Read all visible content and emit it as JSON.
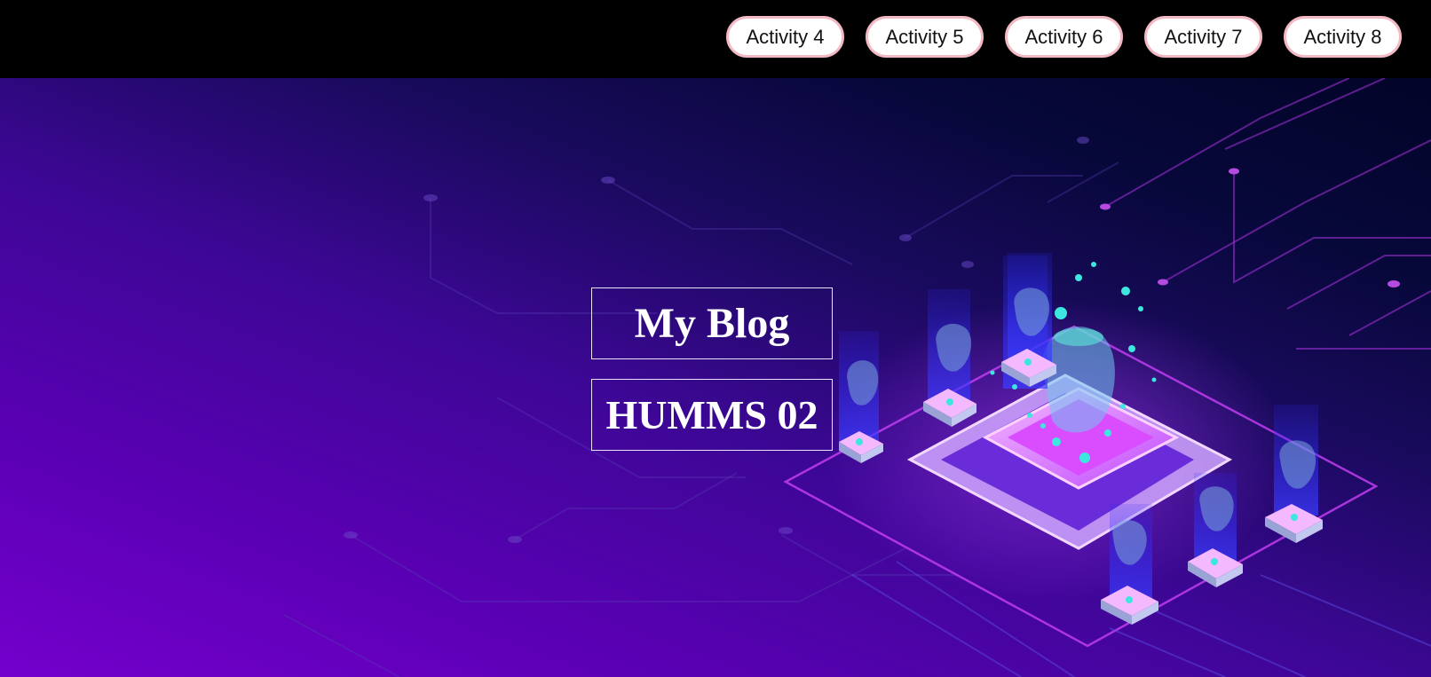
{
  "nav": {
    "items": [
      {
        "label": "Activity 4"
      },
      {
        "label": "Activity 5"
      },
      {
        "label": "Activity 6"
      },
      {
        "label": "Activity 7"
      },
      {
        "label": "Activity 8"
      }
    ]
  },
  "hero": {
    "title": "My Blog",
    "subtitle": "HUMMS 02"
  },
  "colors": {
    "nav_background": "#000000",
    "nav_button_border": "#f3b9c4",
    "hero_purple": "#7400cc",
    "hero_dark_navy": "#030428",
    "accent_magenta": "#e040fb",
    "accent_cyan": "#3ee6e0"
  }
}
